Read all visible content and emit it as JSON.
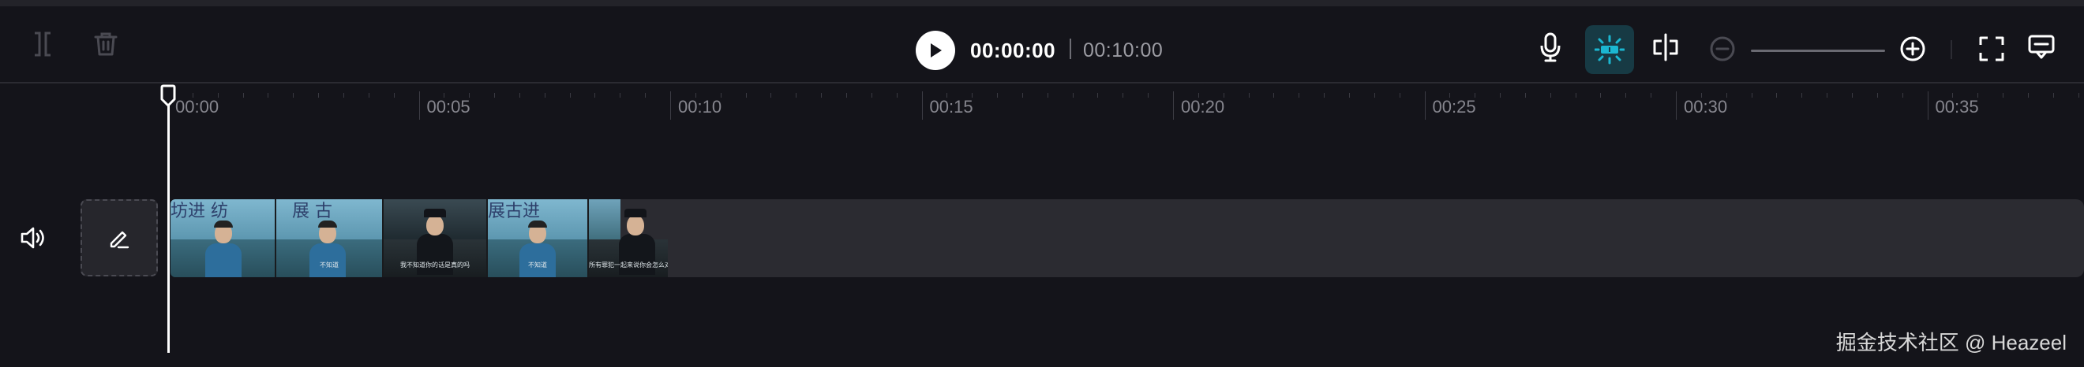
{
  "player": {
    "current_time": "00:00:00",
    "total_time": "00:10:00"
  },
  "toolbar_icons": {
    "left": [
      "split-icon",
      "trash-icon"
    ],
    "right": [
      "microphone-icon",
      "snap-icon",
      "split-screen-icon",
      "zoom-out-icon",
      "zoom-in-icon",
      "fullscreen-icon",
      "comment-icon"
    ]
  },
  "ruler": {
    "labels": [
      "00:00",
      "00:05",
      "00:10",
      "00:15",
      "00:20",
      "00:25",
      "00:30",
      "00:35"
    ]
  },
  "track": {
    "volume_icon": "speaker-icon",
    "cover_icon": "pencil-icon",
    "clip_frames": [
      {
        "banner": "坊进 纺",
        "subtitle": ""
      },
      {
        "banner": "展 古",
        "subtitle": "不知道"
      },
      {
        "banner": "",
        "subtitle": "我不知道你的话是真的吗"
      },
      {
        "banner": "展古进",
        "subtitle": "不知道"
      },
      {
        "banner": "",
        "subtitle": "所有罪犯一起来说你会怎么对待他"
      }
    ]
  },
  "watermark": "掘金技术社区 @ Heazeel",
  "colors": {
    "background": "#14141a",
    "accent": "#1bb7d1",
    "snap_active_bg": "#173a44",
    "track": "#2b2b31"
  }
}
